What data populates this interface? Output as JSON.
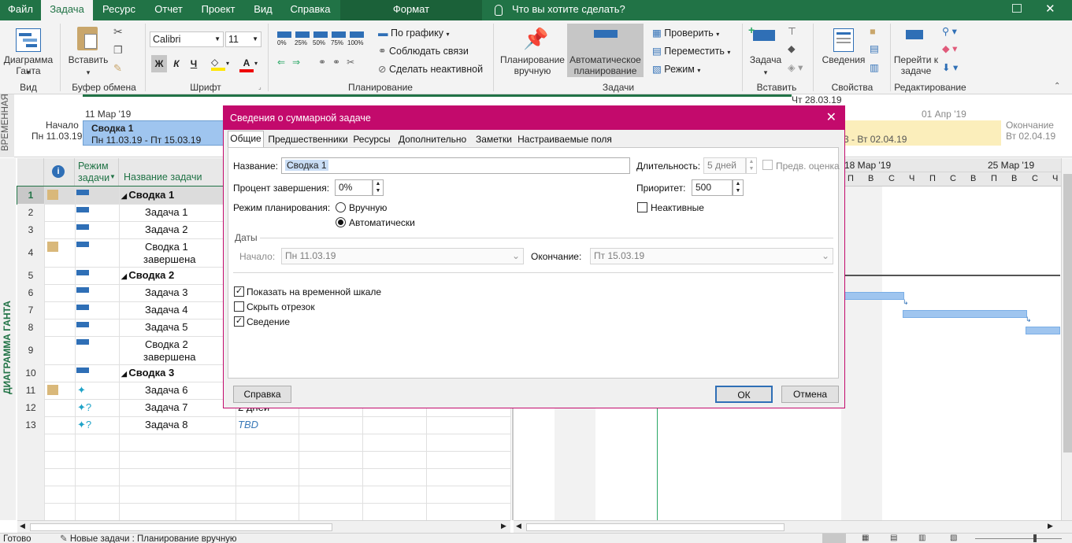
{
  "tabs": [
    "Файл",
    "Задача",
    "Ресурс",
    "Отчет",
    "Проект",
    "Вид",
    "Справка",
    "Формат"
  ],
  "tell_me": "Что вы хотите сделать?",
  "ribbon": {
    "view_group": {
      "button": "Диаграмма Ганта",
      "label": "Вид"
    },
    "clipboard": {
      "paste": "Вставить",
      "label": "Буфер обмена"
    },
    "font": {
      "name": "Calibri",
      "size": "11",
      "bold": "Ж",
      "italic": "К",
      "underline": "Ч",
      "font_color": "А",
      "label": "Шрифт"
    },
    "schedule": {
      "percents": [
        "0%",
        "25%",
        "50%",
        "75%",
        "100%"
      ],
      "on_track": "По графику",
      "respect_links": "Соблюдать связи",
      "inactivate": "Сделать неактивной",
      "label": "Планирование"
    },
    "tasks": {
      "manual": "Планирование вручную",
      "auto": "Автоматическое планирование",
      "inspect": "Проверить",
      "move": "Переместить",
      "mode": "Режим",
      "label": "Задачи"
    },
    "insert": {
      "task": "Задача",
      "label": "Вставить"
    },
    "properties": {
      "info": "Сведения",
      "label": "Свойства"
    },
    "editing": {
      "goto": "Перейти к задаче",
      "label": "Редактирование"
    }
  },
  "timeline": {
    "side_label": "ВРЕМЕННАЯ",
    "start_label": "Начало",
    "start_date": "Пн 11.03.19",
    "end_label": "Окончание",
    "end_date": "Вт 02.04.19",
    "date_top_left": "11 Мар '19",
    "date_top_right": "01 Апр '19",
    "today_mark": "Чт 28.03.19",
    "bar1_name": "Сводка 1",
    "bar1_dates": "Пн 11.03.19 - Пт 15.03.19",
    "bar3_partial_name": "3",
    "bar3_dates": "3 - Вт 02.04.19"
  },
  "grid": {
    "side_label": "ДИАГРАММА ГАНТА",
    "col_info": "i",
    "col_mode": "Режим задачи",
    "col_name": "Название задачи",
    "rows": [
      {
        "n": "1",
        "name": "Сводка 1",
        "summary": true
      },
      {
        "n": "2",
        "name": "Задача 1"
      },
      {
        "n": "3",
        "name": "Задача 2"
      },
      {
        "n": "4",
        "name": "Сводка 1",
        "name2": "завершена"
      },
      {
        "n": "5",
        "name": "Сводка 2",
        "summary": true
      },
      {
        "n": "6",
        "name": "Задача 3"
      },
      {
        "n": "7",
        "name": "Задача 4"
      },
      {
        "n": "8",
        "name": "Задача 5"
      },
      {
        "n": "9",
        "name": "Сводка 2",
        "name2": "завершена"
      },
      {
        "n": "10",
        "name": "Сводка 3",
        "summary": true
      },
      {
        "n": "11",
        "name": "Задача 6"
      },
      {
        "n": "12",
        "name": "Задача 7",
        "duration": "2 дней"
      },
      {
        "n": "13",
        "name": "Задача 8",
        "duration": "TBD"
      }
    ]
  },
  "gantt": {
    "week1": "18 Мар '19",
    "week2": "25 Мар '19",
    "days": [
      "П",
      "В",
      "С",
      "Ч",
      "П",
      "С",
      "В",
      "П",
      "В",
      "С",
      "Ч"
    ]
  },
  "dialog": {
    "title": "Сведения о суммарной задаче",
    "tabs": [
      "Общие",
      "Предшественники",
      "Ресурсы",
      "Дополнительно",
      "Заметки",
      "Настраиваемые поля"
    ],
    "name_label": "Название:",
    "name_value": "Сводка 1",
    "duration_label": "Длительность:",
    "duration_value": "5 дней",
    "estimate_label": "Предв. оценка",
    "percent_label": "Процент завершения:",
    "percent_value": "0%",
    "priority_label": "Приоритет:",
    "priority_value": "500",
    "mode_label": "Режим планирования:",
    "mode_manual": "Вручную",
    "mode_auto": "Автоматически",
    "inactive_label": "Неактивные",
    "dates_label": "Даты",
    "start_label": "Начало:",
    "start_value": "Пн 11.03.19",
    "finish_label": "Окончание:",
    "finish_value": "Пт 15.03.19",
    "show_timeline": "Показать на временной шкале",
    "hide_bar": "Скрыть отрезок",
    "rollup": "Сведение",
    "help": "Справка",
    "ok": "ОК",
    "cancel": "Отмена"
  },
  "status": {
    "ready": "Готово",
    "new_tasks": "Новые задачи : Планирование вручную"
  },
  "colors": {
    "accent": "#217346",
    "dialog": "#c30a6c",
    "bar": "#9fc5ef"
  }
}
